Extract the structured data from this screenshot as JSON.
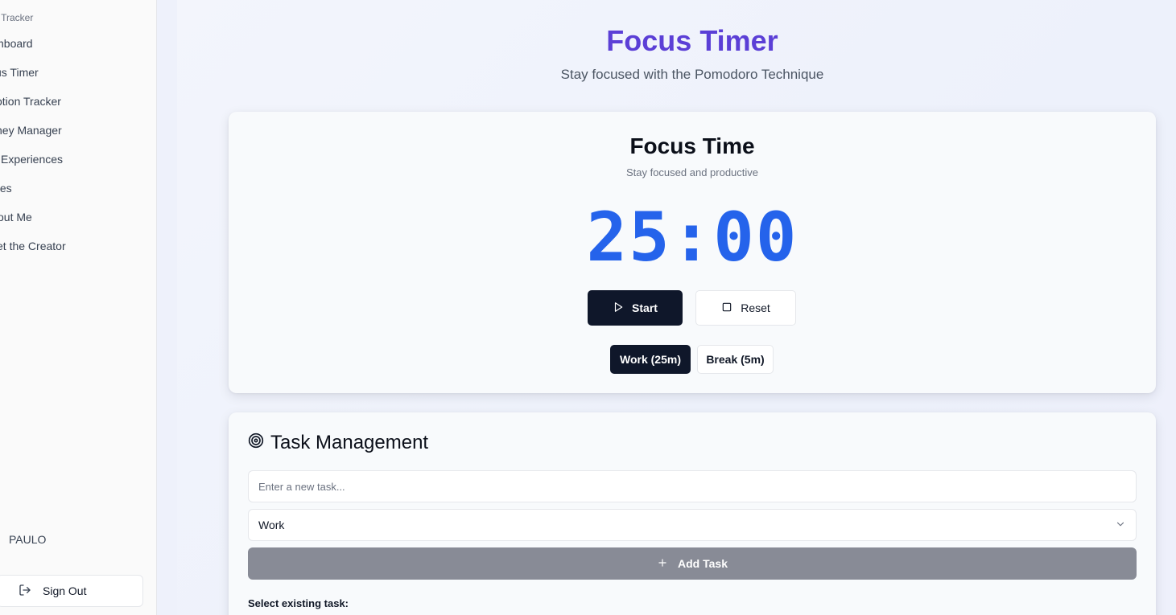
{
  "sidebar": {
    "brand": "rk Tracker",
    "items": [
      {
        "label": "shboard"
      },
      {
        "label": "us Timer"
      },
      {
        "label": "otion Tracker"
      },
      {
        "label": "ney Manager"
      },
      {
        "label": " Experiences"
      },
      {
        "label": "tes"
      },
      {
        "label": "out Me"
      },
      {
        "label": "et the Creator"
      }
    ],
    "user_name": "PAULO",
    "sign_out_label": "Sign Out"
  },
  "header": {
    "title": "Focus Timer",
    "subtitle": "Stay focused with the Pomodoro Technique"
  },
  "timer": {
    "title": "Focus Time",
    "subtitle": "Stay focused and productive",
    "minutes": "25",
    "separator": ":",
    "seconds": "00",
    "start_label": "Start",
    "reset_label": "Reset",
    "modes": [
      {
        "label": "Work (25m)",
        "active": true
      },
      {
        "label": "Break (5m)",
        "active": false
      }
    ]
  },
  "tasks": {
    "title": "Task Management",
    "input_placeholder": "Enter a new task...",
    "category_selected": "Work",
    "add_label": "Add Task",
    "existing_label": "Select existing task:"
  },
  "colors": {
    "accent_title": "#5b3fd6",
    "timer_digits": "#2563eb",
    "dark_button": "#0f172a",
    "add_button_disabled": "#888b96"
  }
}
